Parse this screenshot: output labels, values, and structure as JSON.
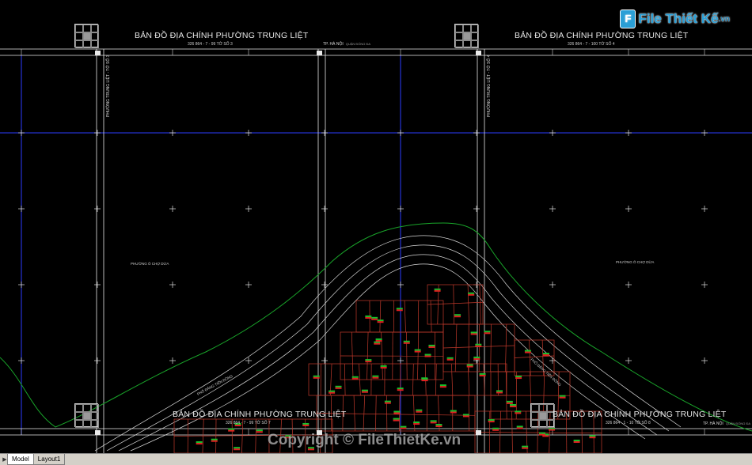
{
  "app": {
    "model_tab": "Model",
    "layout_tab": "Layout1"
  },
  "sheets": [
    {
      "title": "BẢN ĐỒ ĐỊA CHÍNH PHƯỜNG TRUNG LIỆT",
      "subtitle": "326 864 - 7 - 99 TỜ SỐ 3"
    },
    {
      "title": "BẢN ĐỒ ĐỊA CHÍNH PHƯỜNG TRUNG LIỆT",
      "subtitle": "326 864 - 7 - 100 TỜ SỐ 4"
    },
    {
      "title": "BẢN ĐỒ ĐỊA CHÍNH PHƯỜNG TRUNG LIỆT",
      "subtitle": "326 864 - 7 - 99 TỜ SỐ 7"
    },
    {
      "title": "BẢN ĐỒ ĐỊA CHÍNH PHƯỜNG TRUNG LIỆT",
      "subtitle": "326 864 - 1 - 10 TỜ SỐ 8"
    }
  ],
  "labels": {
    "tp_hanoi": "TP. HÀ NỘI",
    "tp_note": "QUẬN ĐỐNG ĐA",
    "ward_left": "PHƯỜNG Ô CHỢ DỪA",
    "ward_right": "PHƯỜNG Ô CHỢ DỪA",
    "vert_1": "PHƯỜNG TRUNG LIỆT - TỜ SỐ 3",
    "vert_2": "PHƯỜNG TRUNG LIỆT - TỜ SỐ 4",
    "road_label": "PHỐ ĐẶNG TIẾN ĐÔNG"
  },
  "watermark": {
    "logo_mark": "F",
    "logo_text": "File Thiết Kế",
    "logo_suffix": ".vn",
    "copyright": "Copyright © FileThietKe.vn"
  },
  "colors": {
    "background": "#000000",
    "frame": "#ffffff",
    "grid_blue": "#2b3bff",
    "contour_green": "#19a52a",
    "parcel_red": "#c0392b",
    "road_white": "#e8e8e8"
  }
}
